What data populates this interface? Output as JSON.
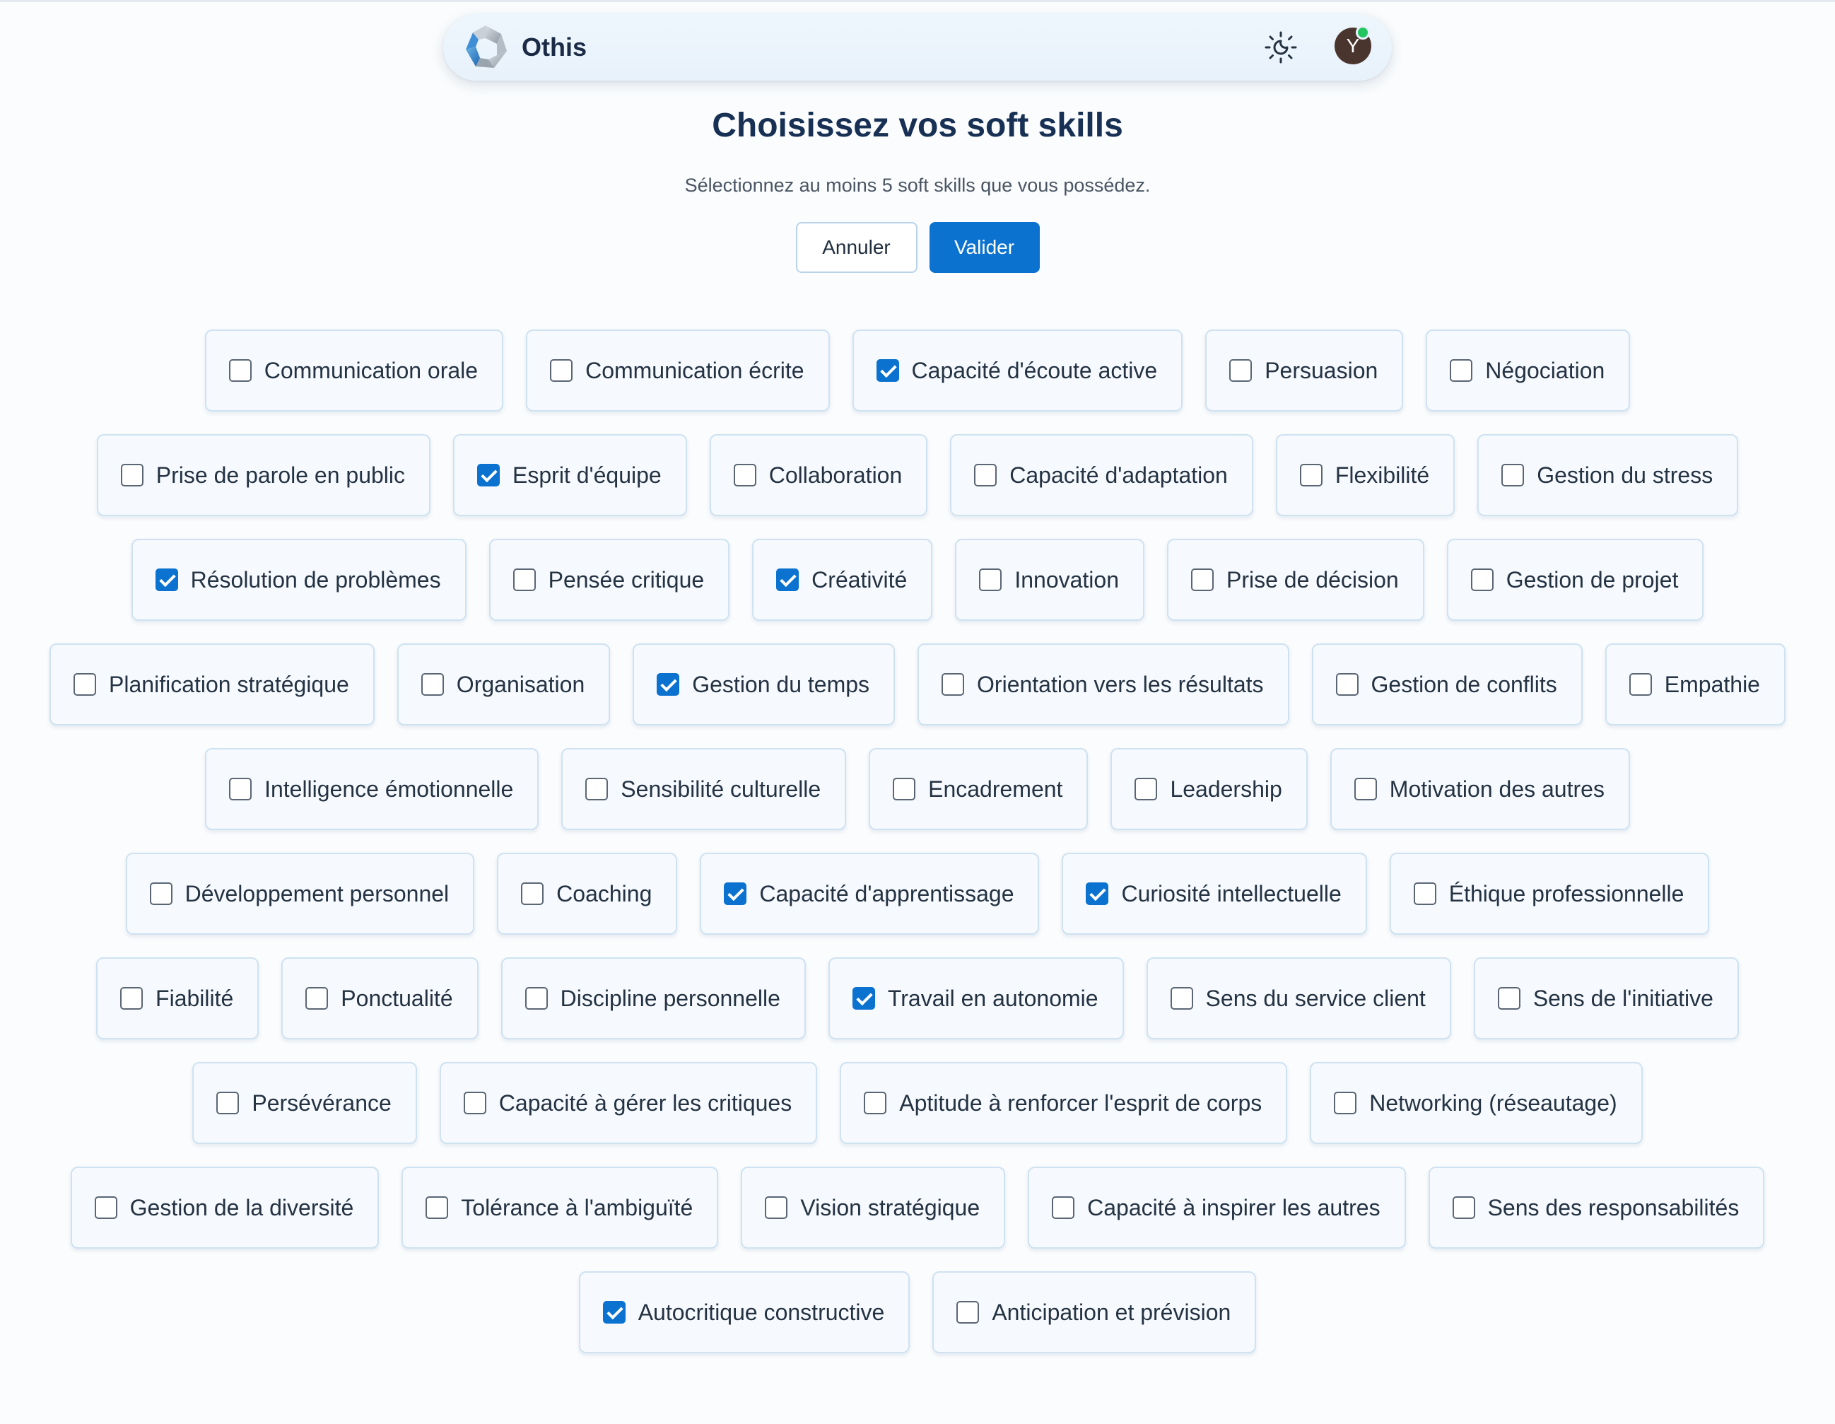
{
  "header": {
    "brand": "Othis",
    "avatar_initial": "Y"
  },
  "page": {
    "title": "Choisissez vos soft skills",
    "subtitle": "Sélectionnez au moins 5 soft skills que vous possédez.",
    "cancel_label": "Annuler",
    "validate_label": "Valider"
  },
  "colors": {
    "accent": "#0b72d0",
    "status_online": "#22c55e"
  },
  "skill_rows": [
    [
      {
        "label": "Communication orale",
        "checked": false
      },
      {
        "label": "Communication écrite",
        "checked": false
      },
      {
        "label": "Capacité d'écoute active",
        "checked": true
      },
      {
        "label": "Persuasion",
        "checked": false
      },
      {
        "label": "Négociation",
        "checked": false
      }
    ],
    [
      {
        "label": "Prise de parole en public",
        "checked": false
      },
      {
        "label": "Esprit d'équipe",
        "checked": true
      },
      {
        "label": "Collaboration",
        "checked": false
      },
      {
        "label": "Capacité d'adaptation",
        "checked": false
      },
      {
        "label": "Flexibilité",
        "checked": false
      },
      {
        "label": "Gestion du stress",
        "checked": false
      }
    ],
    [
      {
        "label": "Résolution de problèmes",
        "checked": true
      },
      {
        "label": "Pensée critique",
        "checked": false
      },
      {
        "label": "Créativité",
        "checked": true
      },
      {
        "label": "Innovation",
        "checked": false
      },
      {
        "label": "Prise de décision",
        "checked": false
      },
      {
        "label": "Gestion de projet",
        "checked": false
      }
    ],
    [
      {
        "label": "Planification stratégique",
        "checked": false
      },
      {
        "label": "Organisation",
        "checked": false
      },
      {
        "label": "Gestion du temps",
        "checked": true
      },
      {
        "label": "Orientation vers les résultats",
        "checked": false
      },
      {
        "label": "Gestion de conflits",
        "checked": false
      },
      {
        "label": "Empathie",
        "checked": false
      }
    ],
    [
      {
        "label": "Intelligence émotionnelle",
        "checked": false
      },
      {
        "label": "Sensibilité culturelle",
        "checked": false
      },
      {
        "label": "Encadrement",
        "checked": false
      },
      {
        "label": "Leadership",
        "checked": false
      },
      {
        "label": "Motivation des autres",
        "checked": false
      }
    ],
    [
      {
        "label": "Développement personnel",
        "checked": false
      },
      {
        "label": "Coaching",
        "checked": false
      },
      {
        "label": "Capacité d'apprentissage",
        "checked": true
      },
      {
        "label": "Curiosité intellectuelle",
        "checked": true
      },
      {
        "label": "Éthique professionnelle",
        "checked": false
      }
    ],
    [
      {
        "label": "Fiabilité",
        "checked": false
      },
      {
        "label": "Ponctualité",
        "checked": false
      },
      {
        "label": "Discipline personnelle",
        "checked": false
      },
      {
        "label": "Travail en autonomie",
        "checked": true
      },
      {
        "label": "Sens du service client",
        "checked": false
      },
      {
        "label": "Sens de l'initiative",
        "checked": false
      }
    ],
    [
      {
        "label": "Persévérance",
        "checked": false
      },
      {
        "label": "Capacité à gérer les critiques",
        "checked": false
      },
      {
        "label": "Aptitude à renforcer l'esprit de corps",
        "checked": false
      },
      {
        "label": "Networking (réseautage)",
        "checked": false
      }
    ],
    [
      {
        "label": "Gestion de la diversité",
        "checked": false
      },
      {
        "label": "Tolérance à l'ambiguïté",
        "checked": false
      },
      {
        "label": "Vision stratégique",
        "checked": false
      },
      {
        "label": "Capacité à inspirer les autres",
        "checked": false
      },
      {
        "label": "Sens des responsabilités",
        "checked": false
      }
    ],
    [
      {
        "label": "Autocritique constructive",
        "checked": true
      },
      {
        "label": "Anticipation et prévision",
        "checked": false
      }
    ]
  ]
}
